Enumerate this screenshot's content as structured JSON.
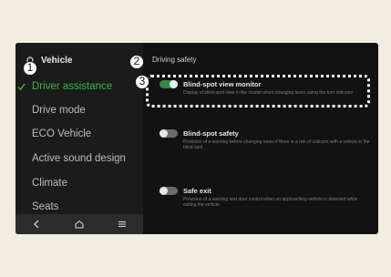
{
  "sidebar": {
    "header": "Vehicle",
    "items": [
      {
        "label": "Driver assistance"
      },
      {
        "label": "Drive mode"
      },
      {
        "label": "ECO Vehicle"
      },
      {
        "label": "Active sound design"
      },
      {
        "label": "Climate"
      },
      {
        "label": "Seats"
      }
    ],
    "bottom_icons": [
      "back-icon",
      "home-icon",
      "menu-icon"
    ]
  },
  "main": {
    "section_title": "Driving safety",
    "settings": [
      {
        "label": "Blind-spot view monitor",
        "enabled": true,
        "description": "Display of blind-spot view in the cluster when changing lanes using the turn indicator"
      },
      {
        "label": "Blind-spot safety",
        "enabled": false,
        "description": "Provision of a warning before changing lanes if there is a risk of collision with a vehicle in the blind spot"
      },
      {
        "label": "Safe exit",
        "enabled": false,
        "description": "Provision of a warning and door control when an approaching vehicle is detected while exiting the vehicle"
      }
    ]
  },
  "callouts": [
    "1",
    "2",
    "3"
  ],
  "colors": {
    "accent": "#37b24d",
    "toggle_on": "#2e8b45",
    "background": "#121212"
  }
}
